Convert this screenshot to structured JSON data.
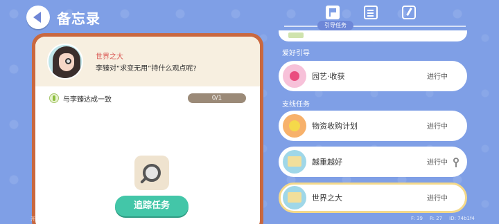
{
  "header": {
    "title": "备忘录"
  },
  "tabs": {
    "active_label": "引导任务"
  },
  "task_detail": {
    "title": "世界之大",
    "description": "李臻对“求变无用”持什么观点呢?",
    "objective": {
      "text": "与李臻达成一致",
      "progress": "0/1"
    },
    "track_button": "追踪任务"
  },
  "sections": [
    {
      "label": "爱好引导"
    },
    {
      "label": "支线任务"
    }
  ],
  "quests": [
    {
      "name": "园艺·收获",
      "status": "进行中",
      "icon": "heart-icon"
    },
    {
      "name": "物资收购计划",
      "status": "进行中",
      "icon": "coin-icon"
    },
    {
      "name": "越重越好",
      "status": "进行中",
      "icon": "map-icon",
      "pinned": true
    },
    {
      "name": "世界之大",
      "status": "进行中",
      "icon": "map-icon",
      "selected": true
    }
  ],
  "footer": {
    "left": "开发测试版本，不代表最终品质",
    "f": "F: 39",
    "r": "R: 27",
    "id": "ID: 74b1f4"
  }
}
